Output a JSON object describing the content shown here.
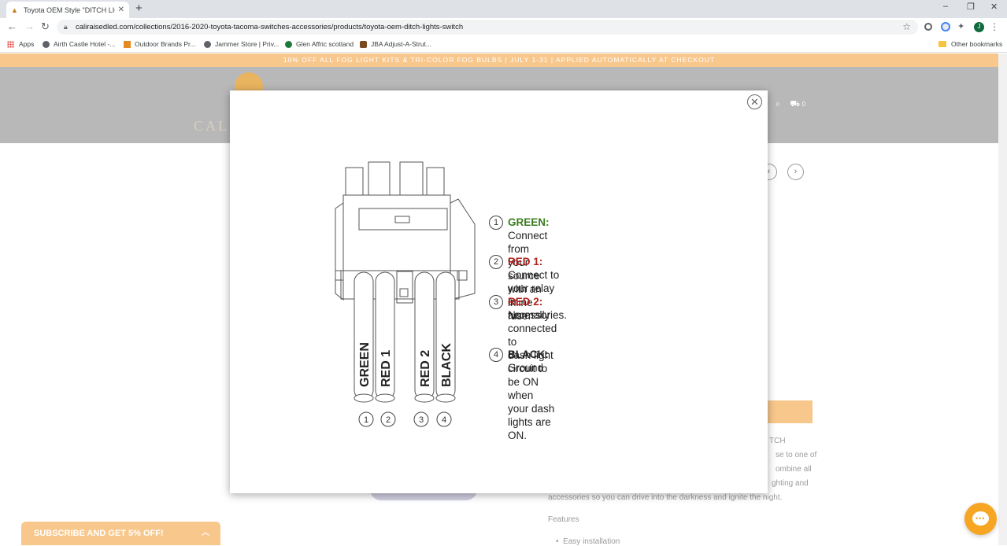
{
  "browser": {
    "tab_title": "Toyota OEM Style \"DITCH LIGHTS",
    "url": "caliraisedled.com/collections/2016-2020-toyota-tacoma-switches-accessories/products/toyota-oem-ditch-lights-switch",
    "bookmarks": [
      "Apps",
      "Airth Castle Hotel -...",
      "Outdoor Brands Pr...",
      "Jammer Store | Priv...",
      "Glen Affric scotland",
      "JBA Adjust-A-Strut..."
    ],
    "other_bookmarks": "Other bookmarks",
    "profile_initial": "J"
  },
  "site": {
    "promo": "10% OFF ALL FOG LIGHT KITS & TRI-COLOR FOG BULBS | JULY 1-31 | APPLIED AUTOMATICALLY AT CHECKOUT",
    "logo_text": "CAL",
    "cart_count": "0",
    "bg_lines": [
      "TCH",
      "se to one of",
      "ombine all",
      "ghting and",
      "accessories so you can drive into the darkness and ignite the night."
    ],
    "features_label": "Features",
    "feature_item": "Easy installation",
    "subscribe_label": "SUBSCRIBE AND GET 5% OFF!"
  },
  "diagram": {
    "wire_labels": [
      "GREEN",
      "RED 1",
      "RED 2",
      "BLACK"
    ],
    "wire_numbers": [
      "1",
      "2",
      "3",
      "4"
    ],
    "legend": [
      {
        "num": "1",
        "keyword": "GREEN:",
        "text_line1": " Connect from your",
        "text_rest": [
          "source with an inline fuse."
        ]
      },
      {
        "num": "2",
        "keyword": "RED 1:",
        "text_line1": " Connect to your relay",
        "text_rest": [
          "or accessories."
        ]
      },
      {
        "num": "3",
        "keyword": "RED 2:",
        "text_line1": " Normally connected to",
        "text_rest": [
          "dash light circuit to be ON when",
          "your dash lights are ON."
        ]
      },
      {
        "num": "4",
        "keyword": "BLACK:",
        "text_line1": " Ground",
        "text_rest": []
      }
    ]
  },
  "colors": {
    "accent": "#f8c78c",
    "green": "#3a7d1e",
    "red": "#b2231e",
    "chat": "#f6a623"
  }
}
